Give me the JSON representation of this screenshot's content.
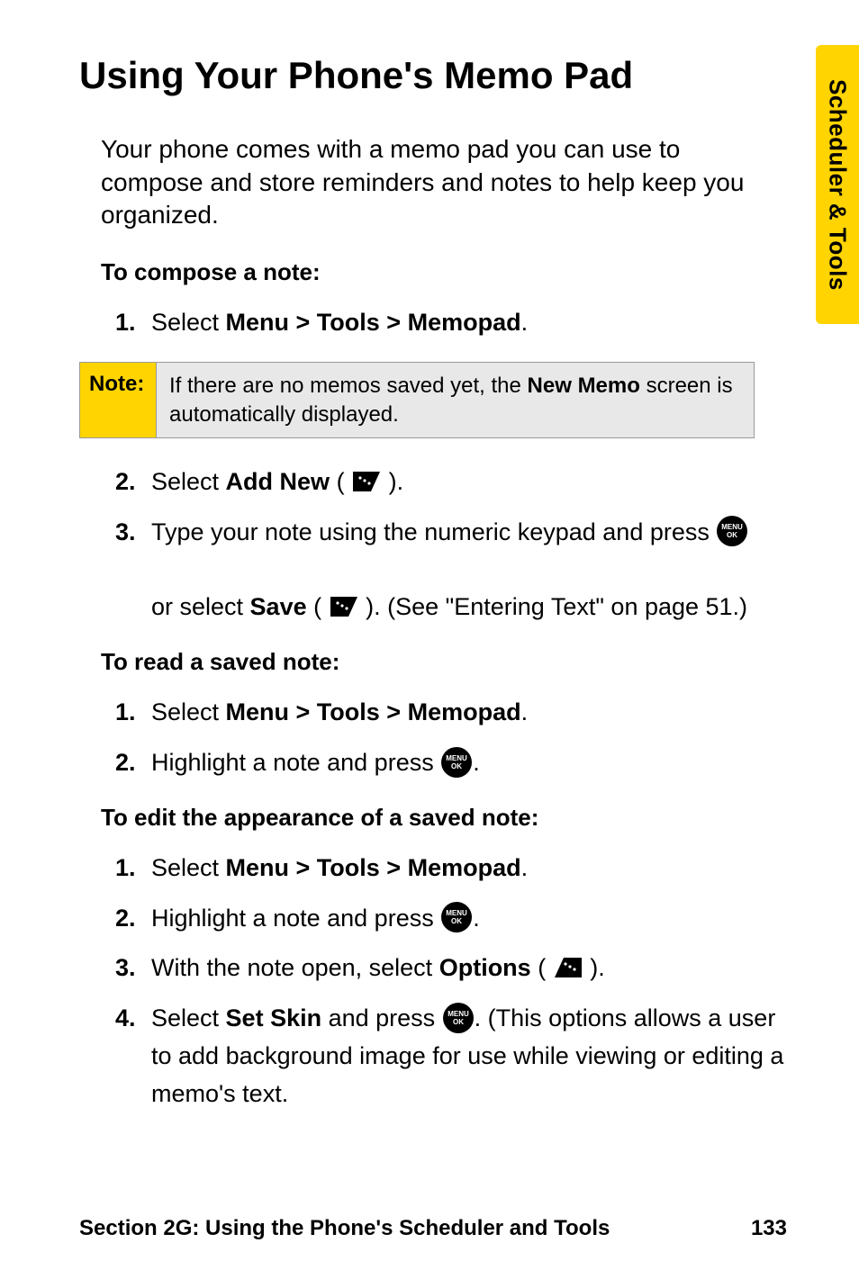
{
  "side_tab": "Scheduler & Tools",
  "title": "Using Your Phone's Memo Pad",
  "intro": "Your phone comes with a memo pad you can use to compose and store reminders and notes to help keep you organized.",
  "compose": {
    "heading": "To compose a note:",
    "step1_pre": "Select ",
    "step1_bold": "Menu > Tools > Memopad",
    "note_label": "Note:",
    "note_pre": "If there are no memos saved yet, the ",
    "note_bold": "New Memo",
    "note_post": " screen is automatically displayed.",
    "step2_pre": "Select ",
    "step2_bold": "Add New",
    "step3_line1": "Type your note using the numeric keypad and press ",
    "step3_line2_pre": "or select ",
    "step3_line2_bold": "Save",
    "step3_line2_post": ". (See \"Entering Text\" on page 51.)"
  },
  "read": {
    "heading": "To read a saved note:",
    "step1_pre": "Select ",
    "step1_bold": "Menu > Tools > Memopad",
    "step2": "Highlight a note and press "
  },
  "edit": {
    "heading": "To edit the appearance of a saved note:",
    "step1_pre": "Select ",
    "step1_bold": "Menu > Tools > Memopad",
    "step2": "Highlight a note and press ",
    "step3_pre": "With the note open, select ",
    "step3_bold": "Options",
    "step4_pre": "Select ",
    "step4_bold": "Set Skin",
    "step4_mid": " and press ",
    "step4_post": ". (This options allows a user to add background image for use while viewing or editing a memo's text."
  },
  "footer": {
    "section": "Section 2G: Using the Phone's Scheduler and Tools",
    "page": "133"
  }
}
